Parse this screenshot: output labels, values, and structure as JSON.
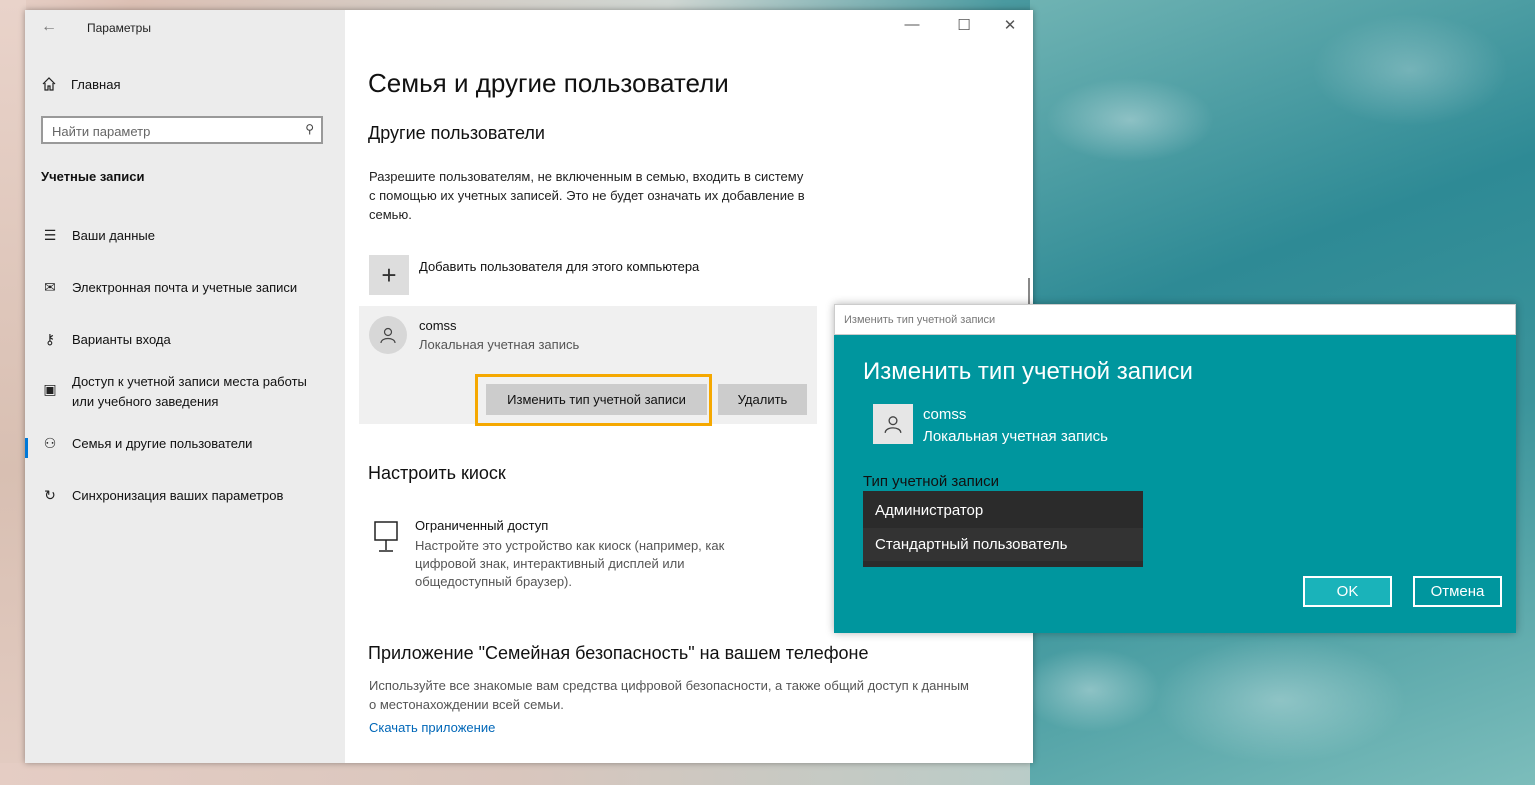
{
  "settings": {
    "app_title": "Параметры",
    "back_icon": "arrow-left-icon",
    "controls": {
      "minimize": "—",
      "maximize": "☐",
      "close": "✕"
    },
    "nav": {
      "home": "Главная",
      "search_placeholder": "Найти параметр",
      "section": "Учетные записи",
      "items": [
        {
          "label": "Ваши данные",
          "icon": "id-card-icon"
        },
        {
          "label": "Электронная почта и учетные записи",
          "icon": "mail-icon"
        },
        {
          "label": "Варианты входа",
          "icon": "key-icon"
        },
        {
          "label": "Доступ к учетной записи места работы или учебного заведения",
          "icon": "briefcase-icon"
        },
        {
          "label": "Семья и другие пользователи",
          "icon": "person-add-icon",
          "active": true
        },
        {
          "label": "Синхронизация ваших параметров",
          "icon": "sync-icon"
        }
      ]
    },
    "main": {
      "title": "Семья и другие пользователи",
      "other_users_heading": "Другие пользователи",
      "other_users_text": "Разрешите пользователям, не включенным в семью, входить в систему с помощью их учетных записей. Это не будет означать их добавление в семью.",
      "add_user_label": "Добавить пользователя для этого компьютера",
      "user": {
        "name": "comss",
        "type": "Локальная учетная запись"
      },
      "change_type_button": "Изменить тип учетной записи",
      "delete_button": "Удалить",
      "kiosk_heading": "Настроить киоск",
      "kiosk_title": "Ограниченный доступ",
      "kiosk_desc": "Настройте это устройство как киоск (например, как цифровой знак, интерактивный дисплей или общедоступный браузер).",
      "family_app_heading": "Приложение \"Семейная безопасность\" на вашем телефоне",
      "family_app_text": "Используйте все знакомые вам средства цифровой безопасности, а также общий доступ к данным о местонахождении всей семьи.",
      "download_link": "Скачать приложение"
    }
  },
  "dialog": {
    "window_title": "Изменить тип учетной записи",
    "heading": "Изменить тип учетной записи",
    "user_name": "comss",
    "user_type": "Локальная учетная запись",
    "account_type_label": "Тип учетной записи",
    "options": [
      "Администратор",
      "Стандартный пользователь"
    ],
    "ok": "OK",
    "cancel": "Отмена",
    "accent_color": "#00969e"
  }
}
